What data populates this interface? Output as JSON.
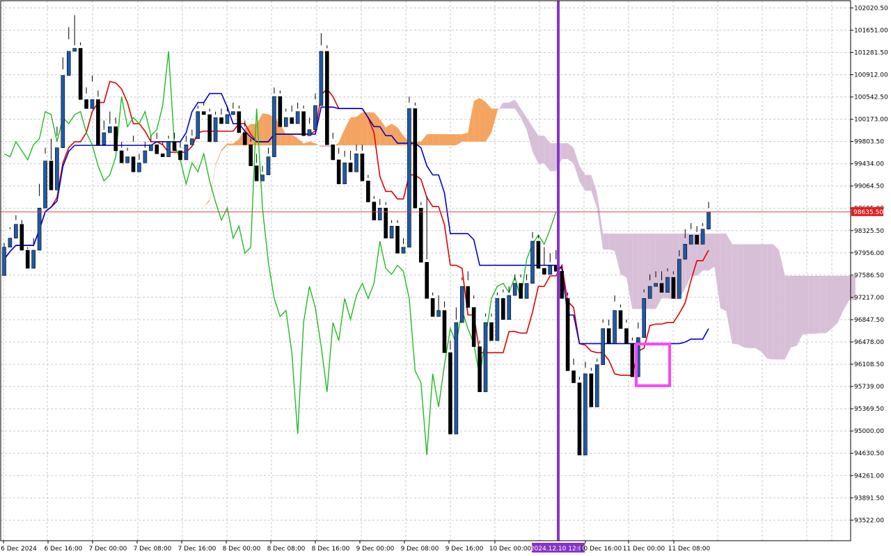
{
  "chart_data": {
    "type": "candlestick",
    "title": "",
    "price_scale": {
      "ticks": [
        "102020.50",
        "101651.00",
        "101281.50",
        "100912.00",
        "100542.50",
        "100173.00",
        "99803.50",
        "99434.00",
        "99064.50",
        "98695.00",
        "98325.50",
        "97956.00",
        "97586.50",
        "97217.00",
        "96847.50",
        "96478.00",
        "96108.50",
        "95739.00",
        "95369.50",
        "95000.00",
        "94630.50",
        "94261.00",
        "93891.50",
        "93522.00"
      ],
      "range": [
        93180,
        102140
      ],
      "current_price": "98635.50",
      "current_price_value": 98635.5
    },
    "time_axis": {
      "labels": [
        "6 Dec 2024",
        "6 Dec 16:00",
        "7 Dec 00:00",
        "7 Dec 08:00",
        "7 Dec 16:00",
        "8 Dec 00:00",
        "8 Dec 08:00",
        "8 Dec 16:00",
        "9 Dec 00:00",
        "9 Dec 08:00",
        "9 Dec 16:00",
        "10 Dec 00:00",
        "2024.12.10 12:00",
        "10 Dec 16:00",
        "11 Dec 00:00",
        "11 Dec 08:00"
      ],
      "marker_label": "2024.12.10 12:00"
    },
    "grid": true,
    "indicator": "Ichimoku Kinko Hyo",
    "colors": {
      "tenkan": "#e00000",
      "kijun": "#0000cc",
      "chikou": "#22bb22",
      "cloud_up": "#f4a460",
      "cloud_down": "#d8bfd8",
      "bull_candle": "#1e5aa8",
      "bear_candle": "#000000",
      "price_line": "#d44040",
      "vline": "#8833cc",
      "highlight_box": "#ff44ff",
      "price_tag_bg": "#e02020",
      "axis_tag_bg": "#8833cc"
    },
    "candles": [
      [
        97580,
        98050,
        97900,
        98050,
        98120
      ],
      [
        98050,
        98350,
        98000,
        98200,
        98380
      ],
      [
        98200,
        98500,
        98150,
        98430,
        98580
      ],
      [
        98430,
        98440,
        97950,
        98000,
        98500
      ],
      [
        98000,
        98020,
        97560,
        97700,
        98050
      ],
      [
        97700,
        98100,
        97680,
        98000,
        98200
      ],
      [
        98000,
        98900,
        97950,
        98700,
        99100
      ],
      [
        98700,
        99600,
        98650,
        99480,
        99700
      ],
      [
        99480,
        99500,
        98800,
        99000,
        99850
      ],
      [
        99000,
        99900,
        98950,
        99700,
        100050
      ],
      [
        99700,
        101000,
        99650,
        100900,
        101200
      ],
      [
        100900,
        101500,
        100850,
        101300,
        101700
      ],
      [
        101300,
        101400,
        101150,
        101350,
        101900
      ],
      [
        101350,
        101400,
        100400,
        100500,
        101450
      ],
      [
        100500,
        100600,
        100250,
        100350,
        100700
      ],
      [
        100350,
        100800,
        100300,
        100500,
        100900
      ],
      [
        100500,
        100550,
        99650,
        99750,
        100650
      ],
      [
        99750,
        100000,
        99700,
        99950,
        100150
      ],
      [
        99950,
        100100,
        99900,
        100050,
        100300
      ],
      [
        100050,
        100100,
        99600,
        99650,
        100200
      ],
      [
        99650,
        99700,
        99300,
        99450,
        99800
      ],
      [
        99450,
        99650,
        99250,
        99550,
        99700
      ],
      [
        99550,
        99800,
        99200,
        99300,
        99900
      ],
      [
        99300,
        99500,
        99000,
        99450,
        99600
      ],
      [
        99450,
        99700,
        99400,
        99650,
        99800
      ],
      [
        99650,
        99800,
        99550,
        99750,
        99900
      ],
      [
        99750,
        99850,
        99500,
        99600,
        99950
      ],
      [
        99600,
        99750,
        99450,
        99550,
        99800
      ],
      [
        99550,
        99850,
        99500,
        99800,
        99900
      ],
      [
        99800,
        99850,
        99550,
        99650,
        99950
      ],
      [
        99650,
        99700,
        99400,
        99500,
        99800
      ],
      [
        99500,
        99800,
        99450,
        99750,
        99900
      ],
      [
        99750,
        99900,
        99650,
        99850,
        100000
      ],
      [
        99850,
        100350,
        99800,
        100300,
        100400
      ],
      [
        100300,
        100400,
        100200,
        100250,
        100450
      ],
      [
        100250,
        100300,
        99750,
        99800,
        100350
      ],
      [
        99800,
        100250,
        99750,
        100200,
        100300
      ],
      [
        100200,
        100250,
        100000,
        100100,
        100350
      ],
      [
        100100,
        100300,
        100050,
        100250,
        100400
      ],
      [
        100250,
        100350,
        100200,
        100300,
        100450
      ],
      [
        100300,
        100350,
        99900,
        99950,
        100400
      ],
      [
        99950,
        100050,
        99700,
        99750,
        100150
      ],
      [
        99750,
        99800,
        99350,
        99400,
        99850
      ],
      [
        99400,
        99450,
        99100,
        99150,
        99600
      ],
      [
        99150,
        99300,
        98900,
        99250,
        99400
      ],
      [
        99250,
        99600,
        99200,
        99550,
        99700
      ],
      [
        99550,
        100600,
        99500,
        100550,
        100700
      ],
      [
        100550,
        100600,
        100000,
        100050,
        100650
      ],
      [
        100050,
        100300,
        99950,
        100200,
        100350
      ],
      [
        100200,
        100300,
        100050,
        100100,
        100400
      ],
      [
        100100,
        100350,
        100000,
        100300,
        100450
      ],
      [
        100300,
        100350,
        99850,
        99900,
        100400
      ],
      [
        99900,
        100100,
        99800,
        100000,
        100200
      ],
      [
        100000,
        100500,
        99950,
        100400,
        100600
      ],
      [
        100400,
        101400,
        100300,
        101300,
        101600
      ],
      [
        101300,
        101350,
        99700,
        99750,
        101400
      ],
      [
        99750,
        99850,
        99400,
        99500,
        99950
      ],
      [
        99500,
        99600,
        98900,
        99100,
        99700
      ],
      [
        99100,
        99550,
        98800,
        99450,
        99650
      ],
      [
        99450,
        99500,
        99200,
        99300,
        99650
      ],
      [
        99300,
        99650,
        99250,
        99600,
        99750
      ],
      [
        99600,
        99650,
        99100,
        99150,
        99750
      ],
      [
        99150,
        99200,
        98750,
        98800,
        99250
      ],
      [
        98800,
        98850,
        98450,
        98500,
        98900
      ],
      [
        98500,
        98750,
        98450,
        98700,
        98850
      ],
      [
        98700,
        98750,
        98150,
        98200,
        98800
      ],
      [
        98200,
        98450,
        98150,
        98400,
        98500
      ],
      [
        98400,
        98450,
        97900,
        97950,
        98500
      ],
      [
        97950,
        98100,
        97850,
        98050,
        98200
      ],
      [
        98050,
        100450,
        98000,
        100350,
        100550
      ],
      [
        100350,
        100400,
        98650,
        98700,
        100450
      ],
      [
        98700,
        98750,
        97750,
        97800,
        98800
      ],
      [
        97800,
        97850,
        97150,
        97200,
        98900
      ],
      [
        97200,
        97250,
        96850,
        96900,
        97300
      ],
      [
        96900,
        97000,
        95400,
        97000,
        97250
      ],
      [
        97000,
        97050,
        96200,
        96300,
        97150
      ],
      [
        96300,
        96350,
        94100,
        94950,
        96500
      ],
      [
        94950,
        96850,
        94900,
        96800,
        97050
      ],
      [
        96800,
        97500,
        96750,
        97400,
        97550
      ],
      [
        97400,
        97500,
        96850,
        97050,
        97650
      ],
      [
        97050,
        97200,
        96300,
        96400,
        97250
      ],
      [
        96400,
        96450,
        95600,
        95650,
        96500
      ],
      [
        95650,
        96900,
        95600,
        96800,
        96950
      ],
      [
        96800,
        96900,
        96450,
        96500,
        96950
      ],
      [
        96500,
        97250,
        96450,
        97200,
        97300
      ],
      [
        97200,
        97300,
        96800,
        96850,
        97350
      ],
      [
        96850,
        97300,
        96800,
        97250,
        97400
      ],
      [
        97250,
        97500,
        97200,
        97450,
        97600
      ],
      [
        97450,
        97550,
        97150,
        97200,
        97600
      ],
      [
        97200,
        97500,
        97150,
        97450,
        97600
      ],
      [
        97450,
        98200,
        97400,
        98150,
        98300
      ],
      [
        98150,
        98200,
        97650,
        97700,
        98250
      ],
      [
        97700,
        97750,
        97550,
        97600,
        98050
      ],
      [
        97600,
        97800,
        97550,
        97750,
        97950
      ],
      [
        97750,
        97850,
        97600,
        97650,
        98000
      ],
      [
        97650,
        97700,
        97100,
        97200,
        97750
      ],
      [
        97200,
        97250,
        95900,
        96000,
        97300
      ],
      [
        96000,
        96100,
        95700,
        95800,
        96200
      ],
      [
        95800,
        95850,
        94500,
        94600,
        95900
      ],
      [
        94600,
        96050,
        94550,
        95950,
        96150
      ],
      [
        95950,
        96000,
        95300,
        95400,
        96050
      ],
      [
        95400,
        96150,
        95350,
        96100,
        96200
      ],
      [
        96100,
        96800,
        96050,
        96700,
        96850
      ],
      [
        96700,
        96750,
        96400,
        96450,
        96850
      ],
      [
        96450,
        97150,
        96400,
        97000,
        97250
      ],
      [
        97000,
        97050,
        96600,
        96700,
        97100
      ],
      [
        96700,
        96800,
        96400,
        96450,
        96850
      ],
      [
        96450,
        96500,
        95850,
        95900,
        96550
      ],
      [
        95900,
        96700,
        95850,
        96550,
        96800
      ],
      [
        96550,
        97300,
        96500,
        97200,
        97350
      ],
      [
        97200,
        97500,
        97150,
        97400,
        97600
      ],
      [
        97400,
        97550,
        97300,
        97450,
        97650
      ],
      [
        97450,
        97500,
        97250,
        97300,
        97650
      ],
      [
        97300,
        97650,
        97250,
        97550,
        97700
      ],
      [
        97550,
        97600,
        97150,
        97200,
        97650
      ],
      [
        97200,
        97900,
        97150,
        97850,
        98000
      ],
      [
        97850,
        98200,
        97800,
        98100,
        98350
      ],
      [
        98100,
        98350,
        98050,
        98250,
        98450
      ],
      [
        98250,
        98300,
        98050,
        98100,
        98400
      ],
      [
        98100,
        98400,
        98050,
        98350,
        98450
      ],
      [
        98350,
        98700,
        98300,
        98635,
        98800
      ]
    ]
  }
}
